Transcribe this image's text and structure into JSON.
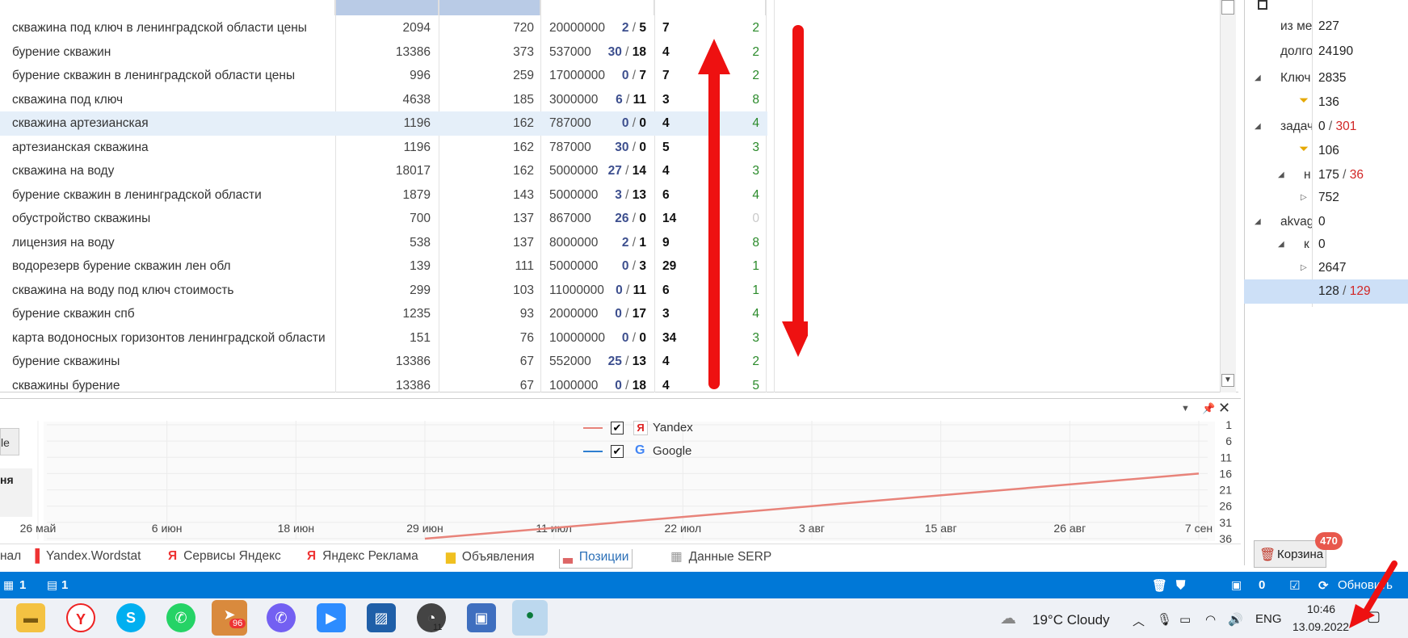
{
  "grid": {
    "rows": [
      {
        "kw": "скважина под ключ в ленинградской области цены",
        "a": "2094",
        "b": "720",
        "c": "20000000",
        "d1": "2",
        "d2": "5",
        "e": "7",
        "f": "2",
        "f_muted": false,
        "hl": false
      },
      {
        "kw": "бурение скважин",
        "a": "13386",
        "b": "373",
        "c": "537000",
        "d1": "30",
        "d2": "18",
        "e": "4",
        "f": "2",
        "f_muted": false,
        "hl": false
      },
      {
        "kw": "бурение скважин в ленинградской области цены",
        "a": "996",
        "b": "259",
        "c": "17000000",
        "d1": "0",
        "d2": "7",
        "e": "7",
        "f": "2",
        "f_muted": false,
        "hl": false
      },
      {
        "kw": "скважина под ключ",
        "a": "4638",
        "b": "185",
        "c": "3000000",
        "d1": "6",
        "d2": "11",
        "e": "3",
        "f": "8",
        "f_muted": false,
        "hl": false
      },
      {
        "kw": "скважина артезианская",
        "a": "1196",
        "b": "162",
        "c": "787000",
        "d1": "0",
        "d2": "0",
        "e": "4",
        "f": "4",
        "f_muted": false,
        "hl": true
      },
      {
        "kw": "артезианская скважина",
        "a": "1196",
        "b": "162",
        "c": "787000",
        "d1": "30",
        "d2": "0",
        "e": "5",
        "f": "3",
        "f_muted": false,
        "hl": false
      },
      {
        "kw": "скважина на воду",
        "a": "18017",
        "b": "162",
        "c": "5000000",
        "d1": "27",
        "d2": "14",
        "e": "4",
        "f": "3",
        "f_muted": false,
        "hl": false
      },
      {
        "kw": "бурение скважин в ленинградской области",
        "a": "1879",
        "b": "143",
        "c": "5000000",
        "d1": "3",
        "d2": "13",
        "e": "6",
        "f": "4",
        "f_muted": false,
        "hl": false
      },
      {
        "kw": "обустройство скважины",
        "a": "700",
        "b": "137",
        "c": "867000",
        "d1": "26",
        "d2": "0",
        "e": "14",
        "f": "0",
        "f_muted": true,
        "hl": false
      },
      {
        "kw": "лицензия на воду",
        "a": "538",
        "b": "137",
        "c": "8000000",
        "d1": "2",
        "d2": "1",
        "e": "9",
        "f": "8",
        "f_muted": false,
        "hl": false
      },
      {
        "kw": "водорезерв бурение скважин лен обл",
        "a": "139",
        "b": "111",
        "c": "5000000",
        "d1": "0",
        "d2": "3",
        "e": "29",
        "f": "1",
        "f_muted": false,
        "hl": false
      },
      {
        "kw": "скважина на воду под ключ стоимость",
        "a": "299",
        "b": "103",
        "c": "11000000",
        "d1": "0",
        "d2": "11",
        "e": "6",
        "f": "1",
        "f_muted": false,
        "hl": false
      },
      {
        "kw": "бурение скважин спб",
        "a": "1235",
        "b": "93",
        "c": "2000000",
        "d1": "0",
        "d2": "17",
        "e": "3",
        "f": "4",
        "f_muted": false,
        "hl": false
      },
      {
        "kw": "карта водоносных горизонтов ленинградской области",
        "a": "151",
        "b": "76",
        "c": "10000000",
        "d1": "0",
        "d2": "0",
        "e": "34",
        "f": "3",
        "f_muted": false,
        "hl": false
      },
      {
        "kw": "бурение скважины",
        "a": "13386",
        "b": "67",
        "c": "552000",
        "d1": "25",
        "d2": "13",
        "e": "4",
        "f": "2",
        "f_muted": false,
        "hl": false
      },
      {
        "kw": "скважины бурение",
        "a": "13386",
        "b": "67",
        "c": "1000000",
        "d1": "0",
        "d2": "18",
        "e": "4",
        "f": "5",
        "f_muted": false,
        "hl": false
      }
    ]
  },
  "tree": {
    "items": [
      {
        "name": "из ме",
        "v1": "227",
        "v2": ""
      },
      {
        "name": "долго",
        "v1": "24190",
        "v2": ""
      },
      {
        "name": "Ключ",
        "v1": "2835",
        "v2": ""
      },
      {
        "name": "",
        "v1": "136",
        "v2": ""
      },
      {
        "name": "задач",
        "v1": "0",
        "v2": "301"
      },
      {
        "name": "",
        "v1": "106",
        "v2": ""
      },
      {
        "name": "н",
        "v1": "175",
        "v2": "36"
      },
      {
        "name": "",
        "v1": "752",
        "v2": ""
      },
      {
        "name": "akvag",
        "v1": "0",
        "v2": ""
      },
      {
        "name": "к",
        "v1": "0",
        "v2": ""
      },
      {
        "name": "",
        "v1": "2647",
        "v2": ""
      },
      {
        "name": "",
        "v1": "128",
        "v2": "129"
      }
    ]
  },
  "chart": {
    "left_tab_label": "le",
    "left_pane_label": "ня",
    "chart_data": {
      "type": "line",
      "title": "",
      "x_ticks": [
        "26 май",
        "6 июн",
        "18 июн",
        "29 июн",
        "11 июл",
        "22 июл",
        "3 авг",
        "15 авг",
        "26 авг",
        "7 сен"
      ],
      "y_ticks": [
        "1",
        "6",
        "11",
        "16",
        "21",
        "26",
        "31",
        "36"
      ],
      "ylim": [
        1,
        36
      ],
      "y_reversed": true,
      "grid": true,
      "legend_position": "top-center",
      "series": [
        {
          "name": "Yandex",
          "color": "#e8837a",
          "checked": true,
          "points": [
            [
              "29 июн",
              36
            ],
            [
              "7 сен",
              16
            ]
          ]
        },
        {
          "name": "Google",
          "color": "#2f7fd0",
          "checked": true,
          "points": []
        }
      ]
    }
  },
  "tabs": [
    {
      "label": "нал",
      "active": false,
      "icon": ""
    },
    {
      "label": "Yandex.Wordstat",
      "active": false,
      "icon": "bar-chart-icon"
    },
    {
      "label": "Сервисы Яндекс",
      "active": false,
      "icon": "yandex-icon"
    },
    {
      "label": "Яндекс Реклама",
      "active": false,
      "icon": "yandex-ads-icon"
    },
    {
      "label": "Объявления",
      "active": false,
      "icon": "folder-icon"
    },
    {
      "label": "Позиции",
      "active": true,
      "icon": "podium-icon"
    },
    {
      "label": "Данные SERP",
      "active": false,
      "icon": "table-icon"
    }
  ],
  "trash": {
    "label": "Корзина",
    "badge": "470"
  },
  "status": {
    "left1": "1",
    "left2": "1",
    "count": "0",
    "refresh_label": "Обновить"
  },
  "taskbar": {
    "apps": [
      "file-explorer",
      "yandex-browser",
      "skype",
      "whatsapp",
      "telegram",
      "viber",
      "zoom",
      "photo-viewer",
      "speedtest",
      "remote-desktop",
      "app"
    ],
    "telegram_badge": "96",
    "speed_badge": "11",
    "weather": "19°C  Cloudy",
    "lang": "ENG",
    "time": "10:46",
    "date": "13.09.2022"
  }
}
